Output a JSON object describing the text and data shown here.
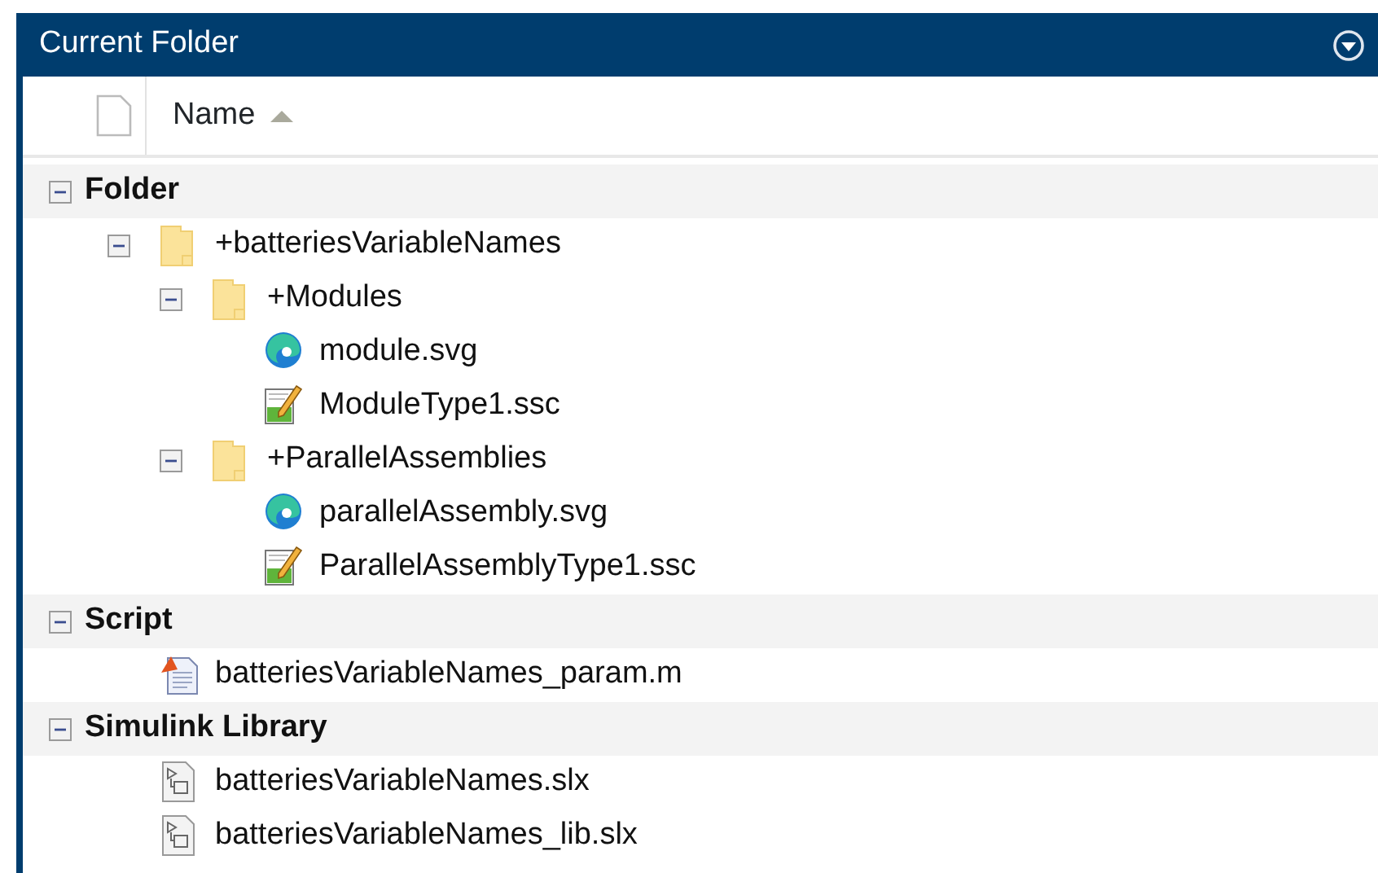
{
  "panel": {
    "title": "Current Folder"
  },
  "header": {
    "column": "Name",
    "sort_ascending": true
  },
  "groups": [
    {
      "label": "Folder",
      "expanded": true,
      "items": [
        {
          "kind": "folder",
          "name": "+batteriesVariableNames",
          "expanded": true,
          "children": [
            {
              "kind": "folder",
              "name": "+Modules",
              "expanded": true,
              "children": [
                {
                  "kind": "svg",
                  "name": "module.svg"
                },
                {
                  "kind": "ssc",
                  "name": "ModuleType1.ssc"
                }
              ]
            },
            {
              "kind": "folder",
              "name": "+ParallelAssemblies",
              "expanded": true,
              "children": [
                {
                  "kind": "svg",
                  "name": "parallelAssembly.svg"
                },
                {
                  "kind": "ssc",
                  "name": "ParallelAssemblyType1.ssc"
                }
              ]
            }
          ]
        }
      ]
    },
    {
      "label": "Script",
      "expanded": true,
      "items": [
        {
          "kind": "script",
          "name": "batteriesVariableNames_param.m"
        }
      ]
    },
    {
      "label": "Simulink Library",
      "expanded": true,
      "items": [
        {
          "kind": "model",
          "name": "batteriesVariableNames.slx"
        },
        {
          "kind": "model",
          "name": "batteriesVariableNames_lib.slx"
        }
      ]
    }
  ]
}
